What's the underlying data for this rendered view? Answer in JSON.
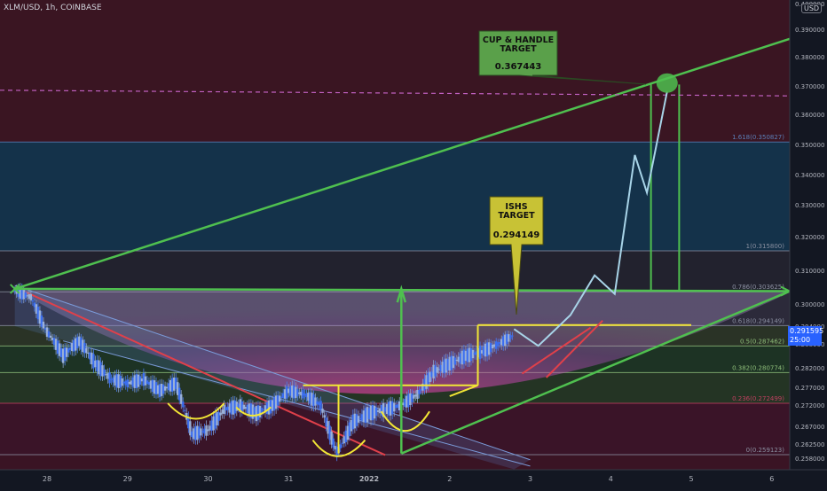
{
  "header": {
    "symbol_line": "XLM/USD, 1h, COINBASE"
  },
  "currency_label": "USD",
  "chart_data": {
    "type": "line",
    "title": "",
    "ylim": [
      0.2565,
      0.405
    ],
    "x_ticks": [
      "28",
      "29",
      "30",
      "31",
      "2022",
      "2",
      "3",
      "4",
      "5",
      "6"
    ],
    "y_ticks": [
      "0.400000",
      "0.390000",
      "0.380000",
      "0.370000",
      "0.360000",
      "0.350000",
      "0.340000",
      "0.330000",
      "0.320000",
      "0.310000",
      "0.300000",
      "0.294000",
      "0.288000",
      "0.282000",
      "0.277000",
      "0.272000",
      "0.267000",
      "0.262500",
      "0.258000"
    ],
    "fib_levels": [
      {
        "ratio": 1.618,
        "label": "1.618(0.350827)",
        "price": 0.350827
      },
      {
        "ratio": 1,
        "label": "1(0.315800)",
        "price": 0.3158
      },
      {
        "ratio": 0.786,
        "label": "0.786(0.303625)",
        "price": 0.303625
      },
      {
        "ratio": 0.618,
        "label": "0.618(0.294149)",
        "price": 0.294149
      },
      {
        "ratio": 0.5,
        "label": "0.5(0.287462)",
        "price": 0.287462
      },
      {
        "ratio": 0.382,
        "label": "0.382(0.280774)",
        "price": 0.280774
      },
      {
        "ratio": 0.236,
        "label": "0.236(0.272499)",
        "price": 0.272499
      },
      {
        "ratio": 0,
        "label": "0(0.259123)",
        "price": 0.259123
      }
    ],
    "current_price": {
      "value": "0.291595",
      "countdown": "25:00"
    },
    "annotations": [
      {
        "title_line1": "CUP & HANDLE",
        "title_line2": "TARGET",
        "value": "0.367443"
      },
      {
        "title_line1": "ISHS",
        "title_line2": "TARGET",
        "value": "0.294149"
      }
    ],
    "price_path": [
      [
        27.6,
        0.304
      ],
      [
        27.8,
        0.302
      ],
      [
        28.0,
        0.292
      ],
      [
        28.2,
        0.285
      ],
      [
        28.4,
        0.289
      ],
      [
        28.6,
        0.283
      ],
      [
        28.8,
        0.279
      ],
      [
        29.0,
        0.278
      ],
      [
        29.2,
        0.279
      ],
      [
        29.4,
        0.276
      ],
      [
        29.6,
        0.278
      ],
      [
        29.8,
        0.265
      ],
      [
        30.0,
        0.266
      ],
      [
        30.2,
        0.271
      ],
      [
        30.4,
        0.272
      ],
      [
        30.6,
        0.27
      ],
      [
        30.8,
        0.272
      ],
      [
        31.0,
        0.276
      ],
      [
        31.2,
        0.275
      ],
      [
        31.4,
        0.272
      ],
      [
        31.6,
        0.26
      ],
      [
        31.8,
        0.268
      ],
      [
        32.0,
        0.27
      ],
      [
        32.2,
        0.271
      ],
      [
        32.4,
        0.272
      ],
      [
        32.6,
        0.275
      ],
      [
        32.8,
        0.281
      ],
      [
        33.0,
        0.283
      ],
      [
        33.2,
        0.285
      ],
      [
        33.4,
        0.286
      ],
      [
        33.6,
        0.288
      ],
      [
        33.8,
        0.291
      ]
    ],
    "projection_path": [
      [
        33.8,
        0.293
      ],
      [
        34.1,
        0.2875
      ],
      [
        34.5,
        0.297
      ],
      [
        34.8,
        0.3085
      ],
      [
        35.05,
        0.303
      ],
      [
        35.3,
        0.3465
      ],
      [
        35.45,
        0.334
      ],
      [
        35.7,
        0.368
      ]
    ]
  }
}
